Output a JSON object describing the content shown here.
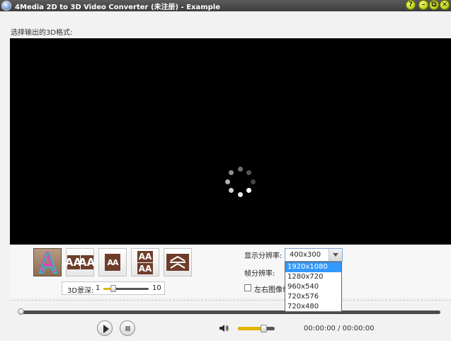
{
  "window": {
    "title": "4Media 2D to 3D Video Converter (未注册) - Example",
    "buttons": {
      "help": "?",
      "minimize": "–",
      "restore": "⧉",
      "close": "×"
    }
  },
  "format_section": {
    "label": "选择输出的3D格式:"
  },
  "preview": {
    "state": "loading",
    "spinner_icon": "loading-spinner-icon"
  },
  "modes": [
    {
      "name": "anaglyph",
      "icon": "anaglyph-a-icon",
      "selected": true
    },
    {
      "name": "side-by-side-full",
      "icon": "aa-side-by-side-icon",
      "text": "AA"
    },
    {
      "name": "side-by-side-half",
      "icon": "aa-side-by-side-half-icon",
      "text": "AA"
    },
    {
      "name": "top-bottom",
      "icon": "aa-top-bottom-icon",
      "text": "AA"
    },
    {
      "name": "interlaced",
      "icon": "interlaced-icon"
    }
  ],
  "depth": {
    "label": "3D景深:",
    "min": "1",
    "max": "10",
    "value": 3
  },
  "settings": {
    "resolution_label": "显示分辨率:",
    "resolution_value": "400x300",
    "framerate_label": "帧分辨率:",
    "swap_lr_label": "左右图像切换",
    "swap_lr_checked": false,
    "resolution_options": [
      "1920x1080",
      "1280x720",
      "960x540",
      "720x576",
      "720x480"
    ],
    "highlighted_option": "1920x1080"
  },
  "playback": {
    "position": 0,
    "volume": 0.7,
    "time_current": "00:00:00",
    "time_separator": "/",
    "time_total": "00:00:00",
    "play_icon": "play-icon",
    "stop_icon": "stop-icon",
    "volume_icon": "speaker-icon"
  },
  "colors": {
    "accent_slider": "#e5b400",
    "selection": "#3399ff",
    "mode_tile": "#6e3e2b"
  }
}
